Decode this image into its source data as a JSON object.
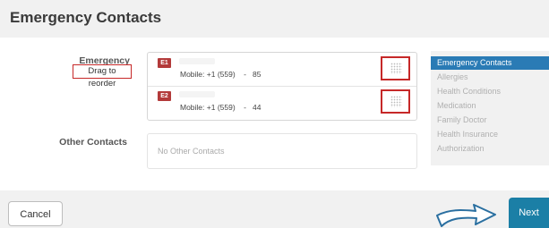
{
  "page": {
    "title": "Emergency Contacts"
  },
  "emergency": {
    "label": "Emergency Contacts",
    "reorder_hint": "Drag to reorder",
    "contacts": [
      {
        "badge": "E1",
        "mobile": "Mobile: +1 (559)    -   85"
      },
      {
        "badge": "E2",
        "mobile": "Mobile: +1 (559)    -   44"
      }
    ]
  },
  "other": {
    "label": "Other Contacts",
    "empty_text": "No Other Contacts"
  },
  "sidenav": {
    "items": [
      {
        "label": "Emergency Contacts",
        "active": true
      },
      {
        "label": "Allergies",
        "active": false
      },
      {
        "label": "Health Conditions",
        "active": false
      },
      {
        "label": "Medication",
        "active": false
      },
      {
        "label": "Family Doctor",
        "active": false
      },
      {
        "label": "Health Insurance",
        "active": false
      },
      {
        "label": "Authorization",
        "active": false
      }
    ]
  },
  "footer": {
    "cancel_label": "Cancel",
    "next_label": "Next"
  },
  "colors": {
    "accent": "#2a7bb5",
    "next": "#1b7fa6",
    "badge": "#b33a3a",
    "highlight": "#c62828"
  },
  "icons": {
    "drag": "drag-handle-icon",
    "arrow": "arrow-right-icon"
  }
}
